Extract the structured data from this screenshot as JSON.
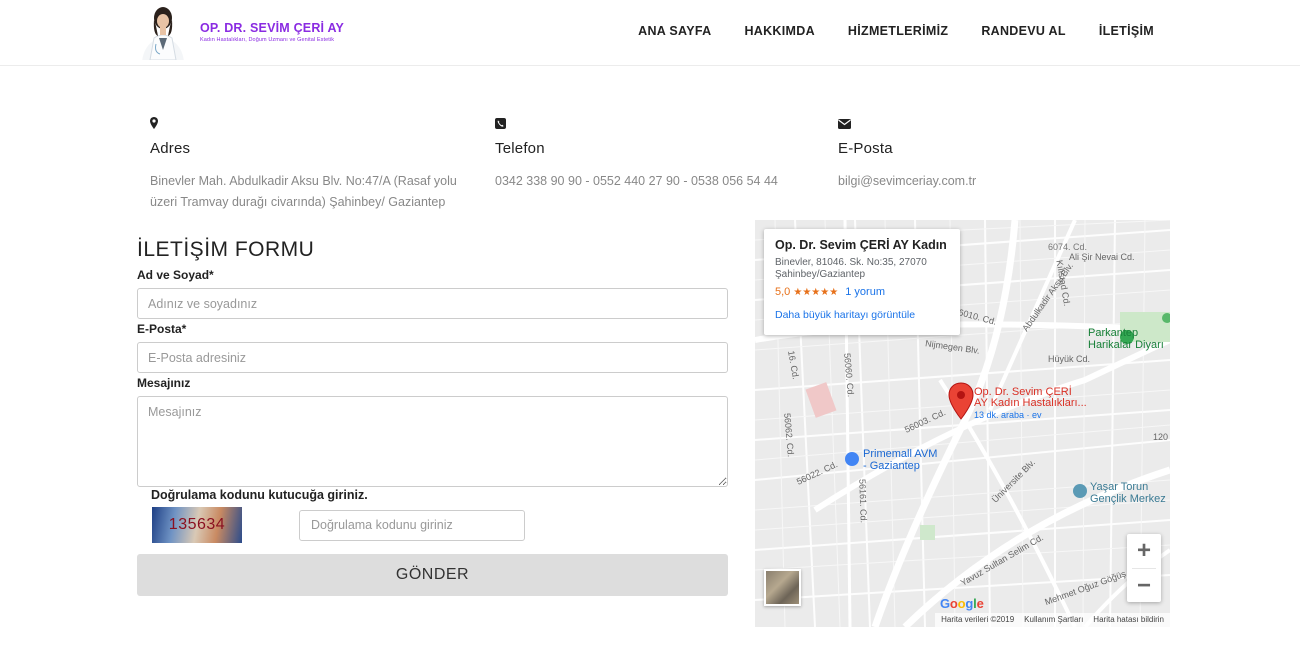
{
  "header": {
    "logo_name": "OP. DR. SEVİM ÇERİ AY",
    "logo_subtitle": "Kadın Hastalıkları, Doğum Uzmanı ve Genital Estetik",
    "nav": [
      {
        "label": "ANA SAYFA"
      },
      {
        "label": "HAKKIMDA"
      },
      {
        "label": "HİZMETLERİMİZ"
      },
      {
        "label": "RANDEVU AL"
      },
      {
        "label": "İLETİŞİM"
      }
    ]
  },
  "contact": {
    "address": {
      "icon": "map-marker-icon",
      "title": "Adres",
      "text": "Binevler Mah. Abdulkadir Aksu Blv. No:47/A (Rasaf yolu üzeri Tramvay durağı civarında) Şahinbey/ Gaziantep"
    },
    "phone": {
      "icon": "phone-icon",
      "title": "Telefon",
      "text": "0342 338 90 90 - 0552 440 27 90 - 0538 056 54 44"
    },
    "email": {
      "icon": "envelope-icon",
      "title": "E-Posta",
      "text": "bilgi@sevimceriay.com.tr"
    }
  },
  "form": {
    "title": "İLETİŞİM FORMU",
    "name_label": "Ad ve Soyad*",
    "name_placeholder": "Adınız ve soyadınız",
    "email_label": "E-Posta*",
    "email_placeholder": "E-Posta adresiniz",
    "message_label": "Mesajınız",
    "message_placeholder": "Mesajınız",
    "captcha_label": "Doğrulama kodunu kutucuğa giriniz.",
    "captcha_code": "135634",
    "captcha_placeholder": "Doğrulama kodunu giriniz",
    "submit_label": "GÖNDER"
  },
  "map": {
    "card_title": "Op. Dr. Sevim ÇERİ AY Kadın H...",
    "card_address_1": "Binevler, 81046. Sk. No:35, 27070",
    "card_address_2": "Şahinbey/Gaziantep",
    "rating": "5,0",
    "stars": "★★★★★",
    "reviews": "1 yorum",
    "larger_map_link": "Daha büyük haritayı görüntüle",
    "pin_label_1": "Op. Dr. Sevim ÇERİ",
    "pin_label_2": "AY Kadın Hastalıkları...",
    "pin_sublabel": "13 dk. araba · ev",
    "poi_park_1": "Parkantep",
    "poi_park_2": "Harikalar Diyarı",
    "poi_mall_1": "Primemall AVM",
    "poi_mall_2": "- Gaziantep",
    "poi_youth_1": "Yaşar Torun",
    "poi_youth_2": "Gençlik Merkez",
    "streets": [
      "Ali Şir Nevai Cd.",
      "Abdulkadir Aksu Blv.",
      "Kılıstad Cd.",
      "Nijmegen Blv.",
      "Hüyük Cd.",
      "56003. Cd.",
      "56062. Cd.",
      "56022. Cd.",
      "56161. Cd.",
      "Üniversite Blv.",
      "Yavuz Sultan Selim Cd.",
      "Mehmet Oğuz Göğüş Cd.",
      "56060. Cd.",
      "6010. Cd.",
      "6074. Cd.",
      "16. Cd.",
      "120"
    ],
    "google_text": "Google",
    "attribution": [
      "Harita verileri ©2019",
      "Kullanım Şartları",
      "Harita hatası bildirin"
    ],
    "zoom_in": "+",
    "zoom_out": "−"
  },
  "colors": {
    "brand": "#8a2be2",
    "pin": "#d93025",
    "link": "#1a73e8",
    "button_bg": "#dddddd"
  }
}
